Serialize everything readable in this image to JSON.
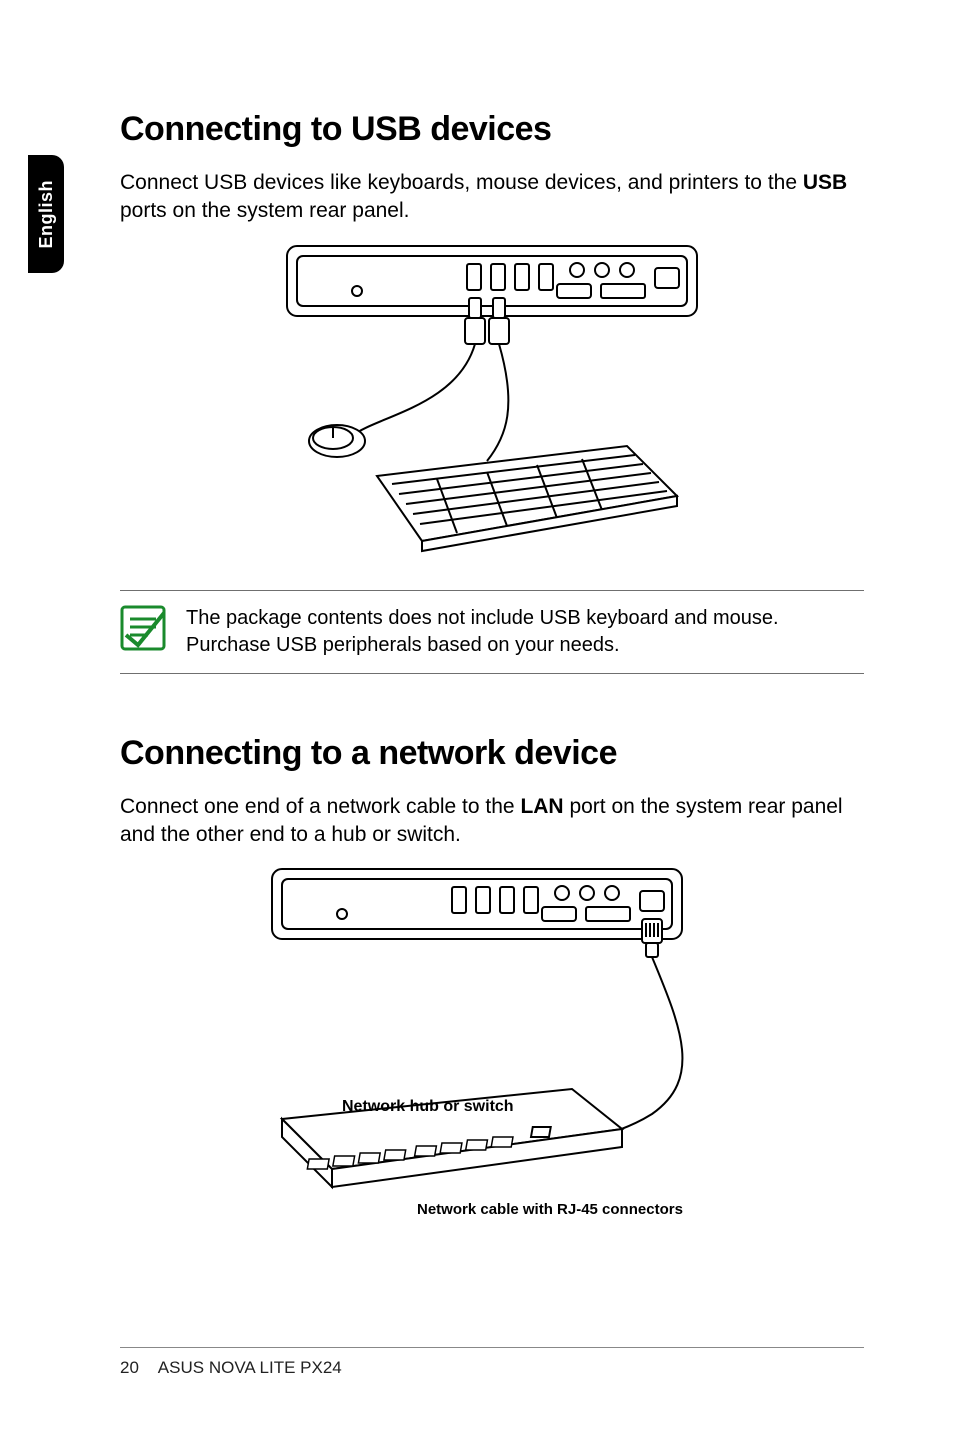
{
  "sidebar": {
    "language": "English"
  },
  "section1": {
    "title": "Connecting to USB devices",
    "body_pre": "Connect USB devices like keyboards, mouse devices, and printers to the ",
    "usb_bold": "USB",
    "body_post": " ports on the system rear panel."
  },
  "note": {
    "line": "The package contents does not include USB keyboard and mouse. Purchase USB peripherals based on your needs."
  },
  "section2": {
    "title": "Connecting to a network device",
    "body_pre": "Connect one end of a network cable to the ",
    "lan_bold": "LAN",
    "body_post": " port on the system rear panel and the other end to a hub or switch."
  },
  "figure_labels": {
    "hub": "Network hub or switch",
    "cable": "Network cable with RJ-45 connectors"
  },
  "footer": {
    "page": "20",
    "product": "ASUS NOVA LITE PX24"
  }
}
